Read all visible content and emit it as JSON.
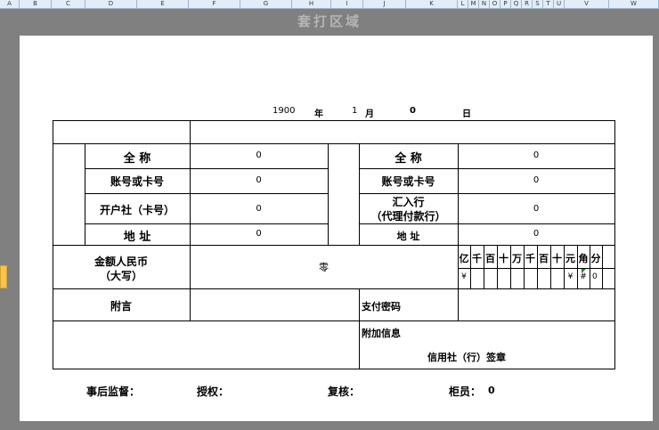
{
  "column_headers": [
    "A",
    "B",
    "C",
    "D",
    "E",
    "F",
    "G",
    "H",
    "I",
    "J",
    "K",
    "L",
    "M",
    "N",
    "O",
    "P",
    "Q",
    "R",
    "S",
    "T",
    "U",
    "V",
    "W"
  ],
  "watermark": "套打区域",
  "date": {
    "year": "1900",
    "year_label": "年",
    "month": "1",
    "month_label": "月",
    "day": "0",
    "day_label": "日"
  },
  "payer": {
    "name_label": "全  称",
    "name_value": "0",
    "account_label": "账号或卡号",
    "account_value": "0",
    "bank_label": "开户社（卡号）",
    "bank_value": "0",
    "address_label": "地  址",
    "address_value": "0"
  },
  "payee": {
    "name_label": "全  称",
    "name_value": "0",
    "account_label": "账号或卡号",
    "account_value": "0",
    "bank_label_line1": "汇入行",
    "bank_label_line2": "（代理付款行）",
    "bank_value": "0",
    "address_label": "地  址",
    "address_value": "0"
  },
  "amount": {
    "label_line1": "金额人民币",
    "label_line2": "（大写）",
    "words": "零",
    "units": [
      "亿",
      "千",
      "百",
      "十",
      "万",
      "千",
      "百",
      "十",
      "元",
      "角",
      "分"
    ],
    "digits": [
      "¥",
      "",
      "",
      "",
      "",
      "",
      "",
      "",
      "¥",
      "#",
      "0"
    ]
  },
  "remarks_label": "附言",
  "password_label": "支付密码",
  "extra_info_label": "附加信息",
  "seal_label": "信用社（行）签章",
  "footer": {
    "supervision": "事后监督：",
    "authorize": "授权：",
    "review": "复核：",
    "teller_label": "柜员：",
    "teller_value": "0"
  }
}
